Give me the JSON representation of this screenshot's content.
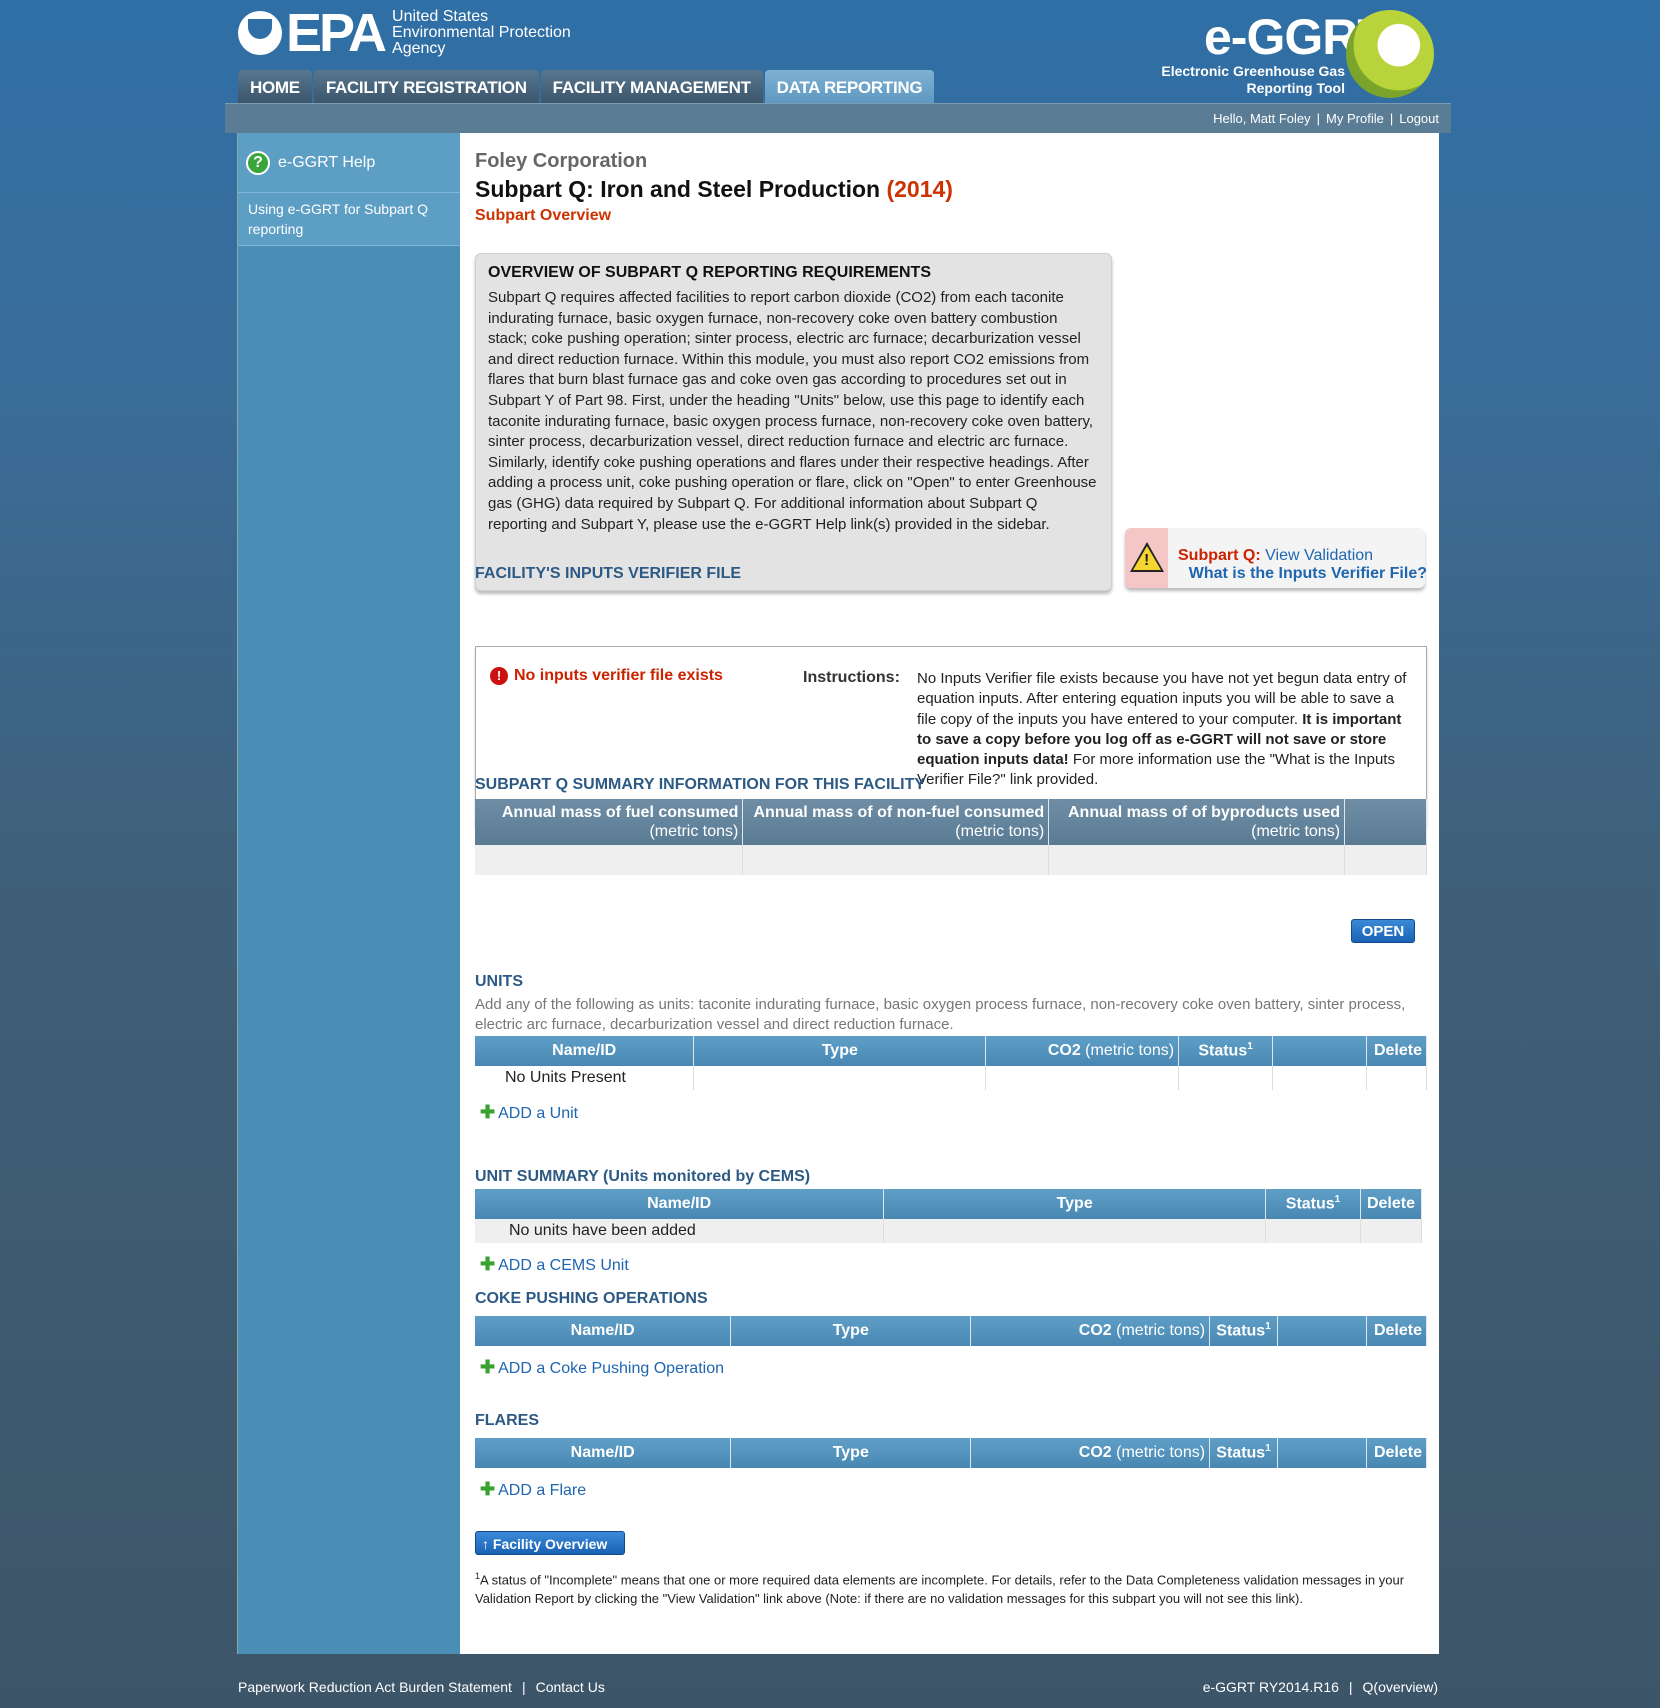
{
  "header": {
    "epa_word": "EPA",
    "agency_name": "United States Environmental Protection Agency",
    "eggrt_brand": "e-GGRT",
    "eggrt_tagline": "Electronic Greenhouse Gas Reporting Tool"
  },
  "nav": {
    "tabs": [
      "HOME",
      "FACILITY REGISTRATION",
      "FACILITY MANAGEMENT",
      "DATA REPORTING"
    ],
    "active": "DATA REPORTING"
  },
  "userbar": {
    "greeting": "Hello, Matt Foley",
    "profile": "My Profile",
    "logout": "Logout"
  },
  "sidebar": {
    "help_title": "e-GGRT Help",
    "help_link": "Using e-GGRT for Subpart Q reporting"
  },
  "page": {
    "company": "Foley Corporation",
    "subpart_title": "Subpart Q: Iron and Steel Production",
    "year": "(2014)",
    "breadcrumb": "Subpart Overview"
  },
  "overview": {
    "heading": "OVERVIEW OF SUBPART Q REPORTING REQUIREMENTS",
    "body": "Subpart Q requires affected facilities to report carbon dioxide (CO2) from each taconite indurating furnace, basic oxygen furnace, non-recovery coke oven battery combustion stack; coke pushing operation; sinter process, electric arc furnace; decarburization vessel and direct reduction furnace. Within this module, you must also report CO2 emissions from flares that burn blast furnace gas and coke oven gas according to procedures set out in Subpart Y of Part 98. First, under the heading \"Units\" below, use this page to identify each taconite indurating furnace, basic oxygen process furnace, non-recovery coke oven battery, sinter process, decarburization vessel, direct reduction furnace and electric arc furnace. Similarly, identify coke pushing operations and flares under their respective headings. After adding a process unit, coke pushing operation or flare, click on \"Open\" to enter Greenhouse gas (GHG) data required by Subpart Q. For additional information about Subpart Q reporting and Subpart Y, please use the e-GGRT Help link(s) provided in the sidebar."
  },
  "validation": {
    "label": "Subpart Q:",
    "link": "View Validation"
  },
  "inputs_verifier": {
    "title": "FACILITY'S INPUTS VERIFIER FILE",
    "help_link": "What is the Inputs Verifier File?",
    "status": "No inputs verifier file exists",
    "instructions_label": "Instructions:",
    "instructions_1": "No Inputs Verifier file exists because you have not yet begun data entry of equation inputs.  After entering equation inputs you will be able to save a file copy of the inputs you have entered to your computer.  ",
    "instructions_bold": "It is important to save a copy before you log off as e-GGRT will not save or store equation inputs data!",
    "instructions_2": " For more information use the \"What is the Inputs Verifier File?\" link provided."
  },
  "summary": {
    "title": "SUBPART Q SUMMARY INFORMATION FOR THIS FACILITY",
    "columns": [
      {
        "label": "Annual mass of fuel consumed",
        "unit": "(metric tons)"
      },
      {
        "label": "Annual mass of of non-fuel consumed",
        "unit": "(metric tons)"
      },
      {
        "label": "Annual mass of of byproducts used",
        "unit": "(metric tons)"
      }
    ],
    "open_button": "OPEN"
  },
  "units": {
    "title": "UNITS",
    "description": "Add any of the following as units: taconite indurating furnace, basic oxygen process furnace, non-recovery coke oven battery, sinter process, electric arc furnace, decarburization vessel and direct reduction furnace.",
    "columns": {
      "name": "Name/ID",
      "type": "Type",
      "co2": "CO2",
      "co2_unit": "(metric tons)",
      "status": "Status",
      "status_sup": "1",
      "delete": "Delete"
    },
    "empty_row": "No Units Present",
    "add_link": "ADD a Unit"
  },
  "cems": {
    "title": "UNIT SUMMARY (Units monitored by CEMS)",
    "columns": {
      "name": "Name/ID",
      "type": "Type",
      "status": "Status",
      "status_sup": "1",
      "delete": "Delete"
    },
    "empty_row": "No units have been added",
    "add_link": "ADD a CEMS Unit"
  },
  "coke": {
    "title": "COKE PUSHING OPERATIONS",
    "columns": {
      "name": "Name/ID",
      "type": "Type",
      "co2": "CO2",
      "co2_unit": "(metric tons)",
      "status": "Status",
      "status_sup": "1",
      "delete": "Delete"
    },
    "add_link": "ADD a Coke Pushing Operation"
  },
  "flares": {
    "title": "FLARES",
    "columns": {
      "name": "Name/ID",
      "type": "Type",
      "co2": "CO2",
      "co2_unit": "(metric tons)",
      "status": "Status",
      "status_sup": "1",
      "delete": "Delete"
    },
    "add_link": "ADD a Flare"
  },
  "facility_button": "Facility Overview",
  "footnote": {
    "sup": "1",
    "text": "A status of \"Incomplete\" means that one or more required data elements are incomplete. For details, refer to the Data Completeness validation messages in your Validation Report by clicking the \"View Validation\" link above (Note: if there are no validation messages for this subpart you will not see this link)."
  },
  "footer": {
    "left": [
      "Paperwork Reduction Act Burden Statement",
      "Contact Us"
    ],
    "right": [
      "e-GGRT RY2014.R16",
      "Q(overview)"
    ]
  }
}
